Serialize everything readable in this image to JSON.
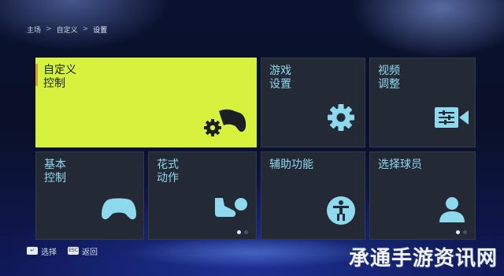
{
  "breadcrumb": {
    "items": [
      "主场",
      "自定义",
      "设置"
    ],
    "separator": ">"
  },
  "tiles": [
    {
      "label": "自定义\n控制",
      "icon": "gamepad-gear-icon",
      "selected": true
    },
    {
      "label": "游戏\n设置",
      "icon": "gear-icon"
    },
    {
      "label": "视频\n调整",
      "icon": "video-settings-icon"
    },
    {
      "label": "基本\n控制",
      "icon": "gamepad-icon"
    },
    {
      "label": "花式\n动作",
      "icon": "boot-ball-icon"
    },
    {
      "label": "辅助功能",
      "icon": "accessibility-icon"
    },
    {
      "label": "选择球员",
      "icon": "player-icon"
    }
  ],
  "footer": {
    "select_key": "↵",
    "select_label": "选择",
    "back_key": "ESC",
    "back_label": "返回"
  },
  "watermark": "承通手游资讯网",
  "colors": {
    "selected_tile": "#d6f23c",
    "tile": "#232a36",
    "label": "#8fd9ee",
    "icon": "#8fd9ee",
    "accent_bar": "#e09a2a"
  }
}
